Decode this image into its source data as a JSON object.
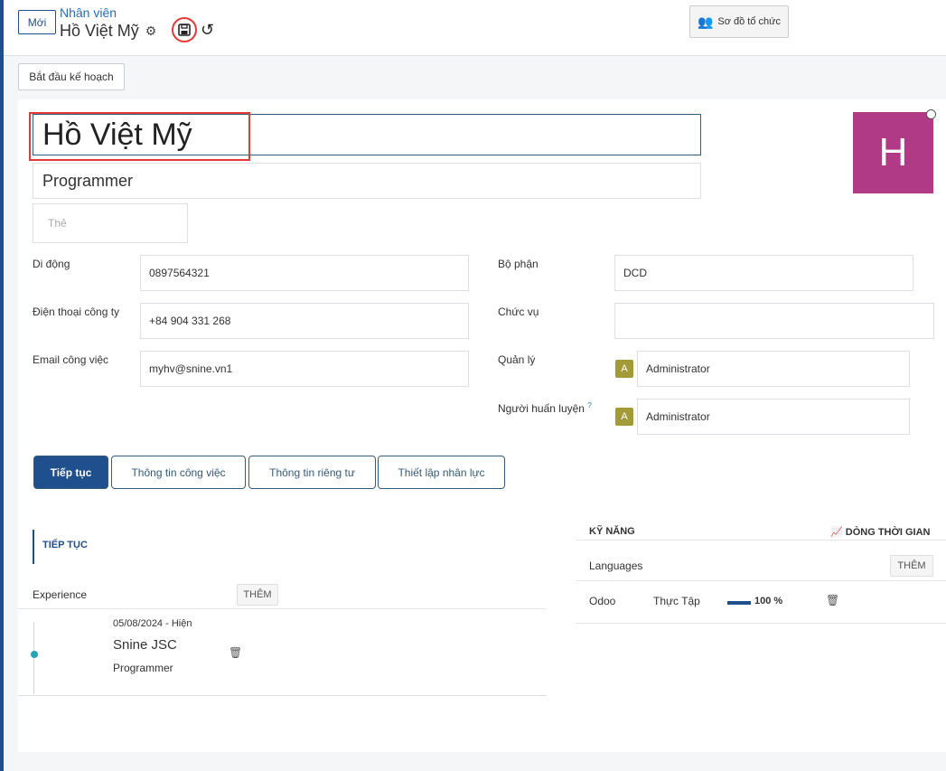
{
  "header": {
    "new_button": "Mới",
    "breadcrumb_parent": "Nhân viên",
    "breadcrumb_current": "Hồ Việt Mỹ",
    "org_chart_button": "Sơ đồ tổ chức",
    "plan_button": "Bắt đầu kế hoạch"
  },
  "employee": {
    "name": "Hồ Việt Mỹ",
    "job_title": "Programmer",
    "tags_placeholder": "Thẻ",
    "avatar_letter": "H",
    "avatar_color": "#b03a86"
  },
  "fields": {
    "mobile_label": "Di động",
    "mobile_value": "0897564321",
    "work_phone_label": "Điện thoại công ty",
    "work_phone_value": "+84 904 331 268",
    "work_email_label": "Email công việc",
    "work_email_value": "myhv@snine.vn1",
    "department_label": "Bộ phận",
    "department_value": "DCD",
    "job_position_label": "Chức vụ",
    "job_position_value": "",
    "manager_label": "Quản lý",
    "manager_badge": "A",
    "manager_value": "Administrator",
    "coach_label": "Người huấn luyện",
    "coach_help": "?",
    "coach_badge": "A",
    "coach_value": "Administrator"
  },
  "tabs": [
    {
      "label": "Tiếp tục"
    },
    {
      "label": "Thông tin công việc"
    },
    {
      "label": "Thông tin riêng tư"
    },
    {
      "label": "Thiết lập nhân lực"
    }
  ],
  "resume": {
    "section_title": "TIẾP TỤC",
    "experience_label": "Experience",
    "add_label": "THÊM",
    "items": [
      {
        "dates": "05/08/2024 - Hiện",
        "company": "Snine JSC",
        "role": "Programmer"
      }
    ]
  },
  "skills": {
    "header": "KỸ NĂNG",
    "timeline_label": "DÒNG THỜI GIAN",
    "group": "Languages",
    "add_label": "THÊM",
    "rows": [
      {
        "skill": "Odoo",
        "level": "Thực Tập",
        "progress": "100 %",
        "progress_fraction": 1.0
      }
    ]
  }
}
